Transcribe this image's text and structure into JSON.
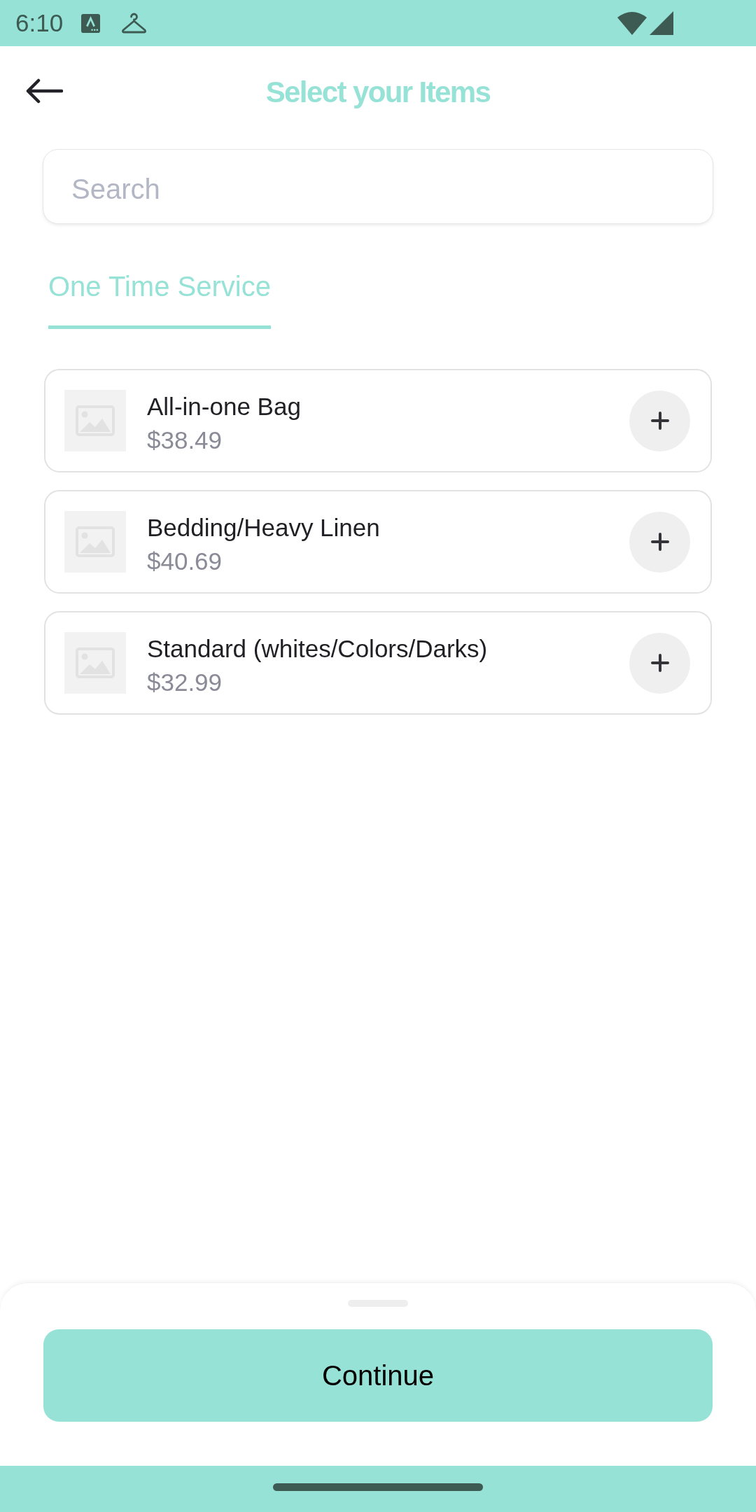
{
  "status_bar": {
    "time": "6:10"
  },
  "header": {
    "title": "Select your Items"
  },
  "search": {
    "placeholder": "Search"
  },
  "tabs": [
    {
      "label": "One Time Service",
      "selected": true
    }
  ],
  "items": [
    {
      "name": "All-in-one Bag",
      "price": "$38.49"
    },
    {
      "name": "Bedding/Heavy Linen",
      "price": "$40.69"
    },
    {
      "name": "Standard (whites/Colors/Darks)",
      "price": "$32.99"
    }
  ],
  "footer": {
    "button": "Continue"
  }
}
